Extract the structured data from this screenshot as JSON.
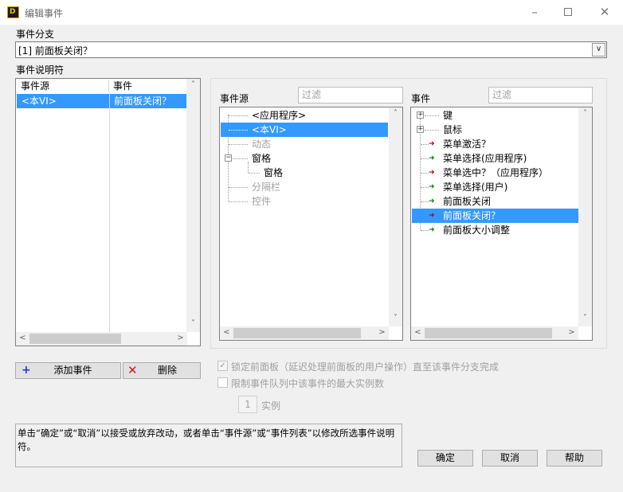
{
  "window": {
    "title": "编辑事件",
    "icon_text": "D",
    "icons": {
      "minimize": "minimize-icon",
      "maximize": "maximize-icon",
      "close": "close-icon"
    }
  },
  "branch": {
    "label": "事件分支",
    "value": "[1] 前面板关闭？"
  },
  "specifiers": {
    "label": "事件说明符",
    "headers": [
      "事件源",
      "事件"
    ],
    "rows": [
      {
        "source": "<本VI>",
        "event": "前面板关闭？"
      }
    ]
  },
  "sources": {
    "label": "事件源",
    "filter_placeholder": "过滤",
    "items": [
      "<应用程序>",
      "<本VI>",
      "动态",
      "窗格",
      "窗格",
      "分隔栏",
      "控件"
    ]
  },
  "events": {
    "label": "事件",
    "filter_placeholder": "过滤",
    "items": [
      "键",
      "鼠标",
      "菜单激活？",
      "菜单选择(应用程序)",
      "菜单选中？（应用程序）",
      "菜单选择(用户)",
      "前面板关闭",
      "前面板关闭？",
      "前面板大小调整"
    ]
  },
  "actions": {
    "add": "添加事件",
    "delete": "删除"
  },
  "options": {
    "lock_panel": "锁定前面板（延迟处理前面板的用户操作）直至该事件分支完成",
    "limit_queue": "限制事件队列中该事件的最大实例数",
    "instances_value": "1",
    "instances_label": "实例"
  },
  "description": "单击“确定”或“取消”以接受或放弃改动，或者单击“事件源”或“事件列表”以修改所选事件说明符。",
  "buttons": {
    "ok": "确定",
    "cancel": "取消",
    "help": "帮助"
  },
  "colors": {
    "selection": "#3399ff",
    "arrow_red": "#c00000",
    "arrow_green": "#008000",
    "add_plus": "#1c3bd6",
    "delete_x": "#d11a1a"
  }
}
